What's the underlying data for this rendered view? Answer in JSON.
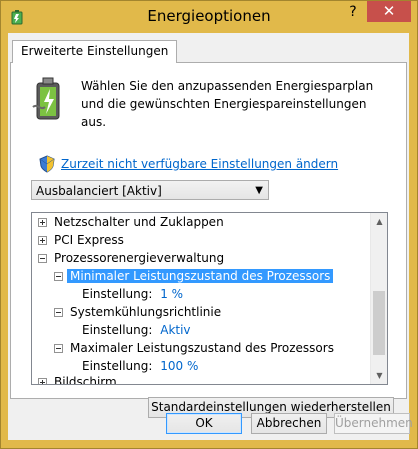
{
  "window": {
    "title": "Energieoptionen",
    "help_glyph": "?",
    "close_glyph": "✕"
  },
  "tab": {
    "label": "Erweiterte Einstellungen"
  },
  "intro": {
    "text": "Wählen Sie den anzupassenden Energiesparplan und die gewünschten Energiespareinstellungen aus."
  },
  "link": {
    "label": "Zurzeit nicht verfügbare Einstellungen ändern"
  },
  "plan_select": {
    "value": "Ausbalanciert [Aktiv]"
  },
  "tree": {
    "items": [
      {
        "label": "Netzschalter und Zuklappen"
      },
      {
        "label": "PCI Express"
      },
      {
        "label": "Prozessorenergieverwaltung"
      },
      {
        "label": "Minimaler Leistungszustand des Prozessors"
      },
      {
        "label": "Einstellung:",
        "value": "1 %"
      },
      {
        "label": "Systemkühlungsrichtlinie"
      },
      {
        "label": "Einstellung:",
        "value": "Aktiv"
      },
      {
        "label": "Maximaler Leistungszustand des Prozessors"
      },
      {
        "label": "Einstellung:",
        "value": "100 %"
      },
      {
        "label": "Bildschirm"
      }
    ]
  },
  "buttons": {
    "restore": "Standardeinstellungen wiederherstellen",
    "ok": "OK",
    "cancel": "Abbrechen",
    "apply": "Übernehmen"
  },
  "colors": {
    "titlebar": "#e1b94a",
    "close": "#c7504b",
    "selection": "#3399ff",
    "link": "#0066cc"
  }
}
